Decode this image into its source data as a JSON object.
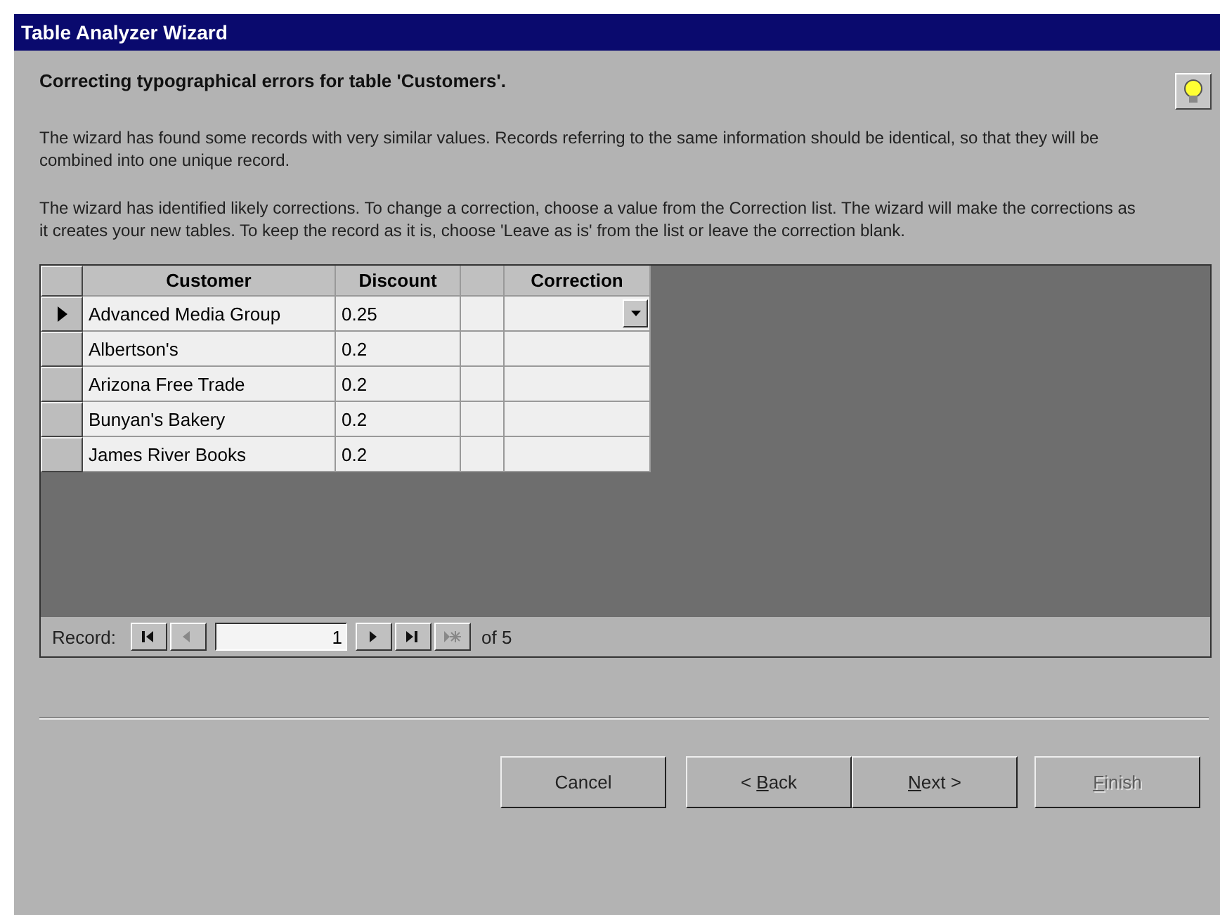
{
  "window": {
    "title": "Table Analyzer Wizard"
  },
  "heading": "Correcting typographical errors for table 'Customers'.",
  "paragraphs": [
    "The wizard has found some records with very similar values. Records referring to the same information should be identical, so that they will be combined into one unique record.",
    "The wizard has identified likely corrections. To change a correction, choose a value from the Correction list.  The wizard will make the corrections as it creates your new tables.  To keep the record as it is, choose 'Leave as is' from the list or leave the correction blank."
  ],
  "table": {
    "columns": [
      {
        "kind": "text",
        "label": "Customer"
      },
      {
        "kind": "text",
        "label": "Discount"
      },
      {
        "kind": "blank"
      },
      {
        "kind": "combo",
        "label": "Correction"
      }
    ],
    "rows": [
      {
        "selected": true,
        "customer": "Advanced Media Group",
        "discount": "0.25"
      },
      {
        "selected": false,
        "customer": "Albertson's",
        "discount": "0.2"
      },
      {
        "selected": false,
        "customer": "Arizona Free Trade",
        "discount": "0.2"
      },
      {
        "selected": false,
        "customer": "Bunyan's Bakery",
        "discount": "0.2"
      },
      {
        "selected": false,
        "customer": "James River Books",
        "discount": "0.2"
      }
    ]
  },
  "navigator": {
    "label": "Record:",
    "buttons": [
      {
        "kind": "first",
        "disabled": false
      },
      {
        "kind": "prev",
        "disabled": true
      }
    ],
    "after": [
      {
        "kind": "next",
        "disabled": false
      },
      {
        "kind": "last",
        "disabled": false
      },
      {
        "kind": "new",
        "disabled": true
      }
    ],
    "value": "1",
    "total": "of 5"
  },
  "buttons": [
    {
      "pre": "Cancel",
      "disabled": false
    },
    {
      "pre": "< ",
      "key": "B",
      "post": "ack",
      "disabled": false
    },
    {
      "key": "N",
      "post": "ext >",
      "disabled": false
    },
    {
      "key": "F",
      "post": "inish",
      "disabled": true
    }
  ]
}
